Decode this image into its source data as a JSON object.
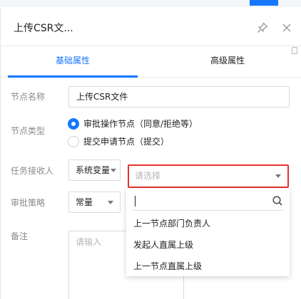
{
  "panel": {
    "title": "上传CSR文...",
    "tabs": [
      {
        "label": "基础属性",
        "active": true
      },
      {
        "label": "高级属性",
        "active": false
      }
    ]
  },
  "form": {
    "node_name": {
      "label": "节点名称",
      "value": "上传CSR文件"
    },
    "node_type": {
      "label": "节点类型",
      "options": [
        {
          "label": "审批操作节点（同意/拒绝等）",
          "checked": true
        },
        {
          "label": "提交申请节点（提交）",
          "checked": false
        }
      ]
    },
    "assignee": {
      "label": "任务接收人",
      "source_value": "系统变量",
      "placeholder": "请选择",
      "dropdown_options": [
        "上一节点部门负责人",
        "发起人直属上级",
        "上一节点直属上级"
      ]
    },
    "approval_strategy": {
      "label": "审批策略",
      "value": "常量"
    },
    "remark": {
      "label": "备注",
      "placeholder": "请输入"
    }
  },
  "colors": {
    "accent": "#1677ff",
    "highlight": "#e5322d"
  }
}
